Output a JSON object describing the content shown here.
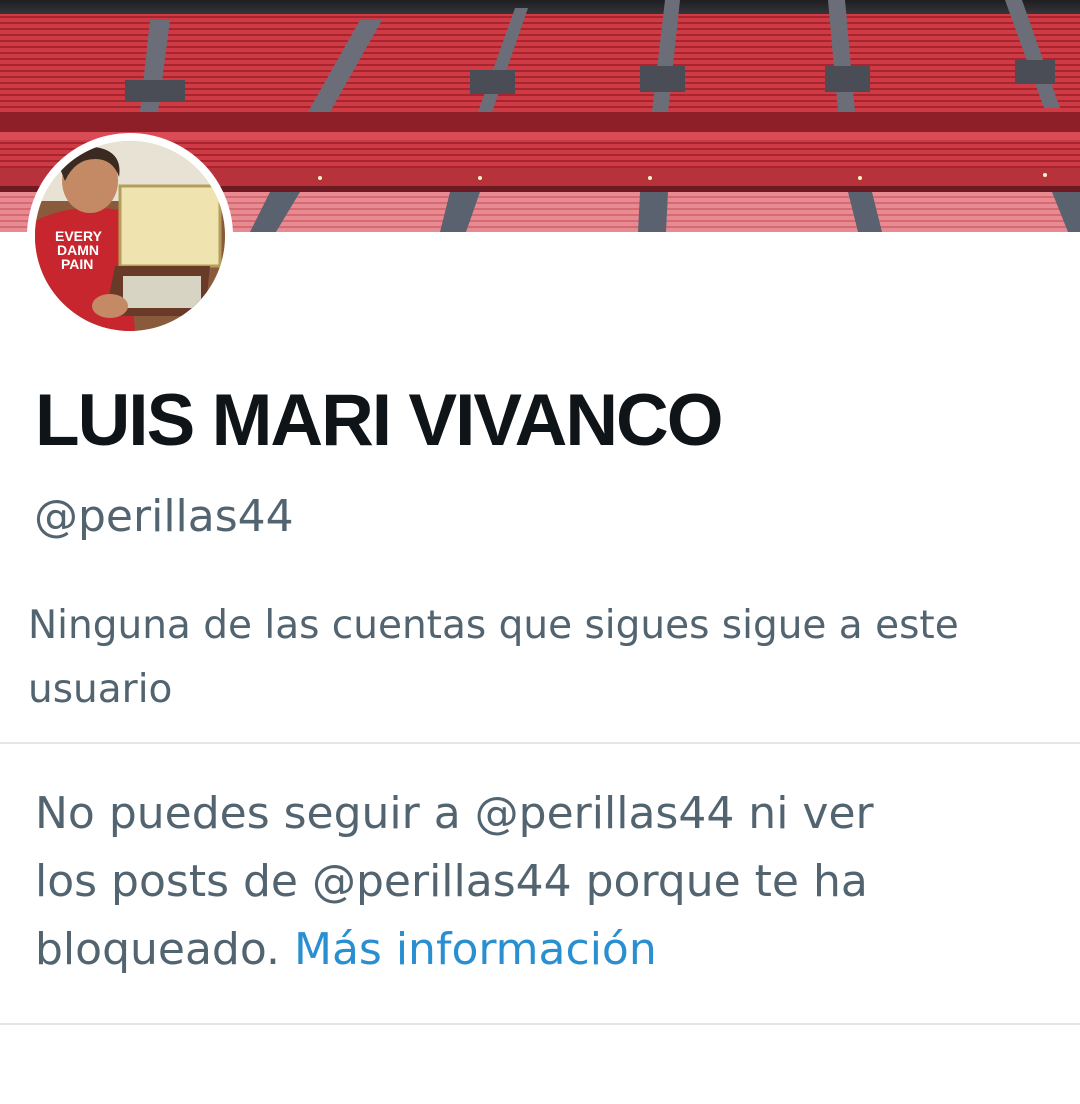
{
  "profile": {
    "display_name": "LUIS MARI VIVANCO",
    "handle": "@perillas44",
    "followers_you_know": "Ninguna de las cuentas que sigues sigue a este usuario",
    "banner_icon": "stadium-banner-image",
    "avatar_icon": "profile-avatar-image"
  },
  "blocked": {
    "line_1": "No puedes seguir a @perillas44 ni ver",
    "line_2": "los posts de @perillas44 porque te ha",
    "line_3_prefix": "bloqueado.",
    "learn_more_label": "Más información"
  },
  "colors": {
    "text_primary": "#0f1419",
    "text_secondary": "#536471",
    "link": "#2a8fd0",
    "divider": "#e3e6e8",
    "banner_red": "#c0303a"
  }
}
